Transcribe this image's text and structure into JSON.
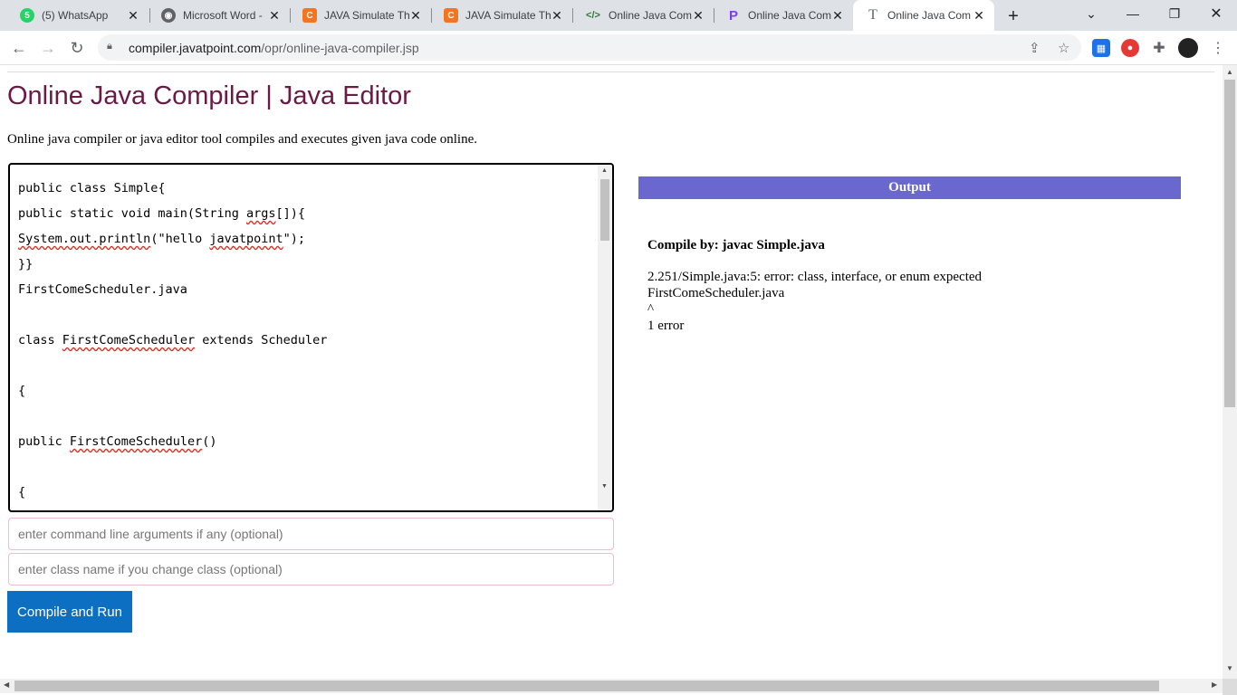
{
  "browser": {
    "tabs": [
      {
        "title": "(5) WhatsApp",
        "favicon": "whatsapp-icon",
        "favicon_glyph": "5",
        "favicon_color": "#25d366"
      },
      {
        "title": "Microsoft Word -",
        "favicon": "globe-icon",
        "favicon_glyph": "◉",
        "favicon_color": "#5f6368"
      },
      {
        "title": "JAVA Simulate Th",
        "favicon": "c-logo-icon",
        "favicon_glyph": "C",
        "favicon_color": "#f4741f"
      },
      {
        "title": "JAVA Simulate Th",
        "favicon": "c-logo-icon",
        "favicon_glyph": "C",
        "favicon_color": "#f4741f"
      },
      {
        "title": "Online Java Com",
        "favicon": "code-icon",
        "favicon_glyph": "</>",
        "favicon_color": "#2e7d32"
      },
      {
        "title": "Online Java Com",
        "favicon": "p-logo-icon",
        "favicon_glyph": "P",
        "favicon_color": "#7b3fe4"
      },
      {
        "title": "Online Java Com",
        "favicon": "t-logo-icon",
        "favicon_glyph": "T",
        "favicon_color": "#5f6368"
      }
    ],
    "active_tab_index": 6,
    "url_domain": "compiler.javatpoint.com",
    "url_path": "/opr/online-java-compiler.jsp"
  },
  "page": {
    "title": "Online Java Compiler | Java Editor",
    "description": "Online java compiler or java editor tool compiles and executes given java code online.",
    "code": [
      "public class Simple{",
      "public static void main(String args[]){",
      "System.out.println(\"hello javatpoint\");",
      "}}",
      "FirstComeScheduler.java",
      "",
      "class FirstComeScheduler extends Scheduler",
      "",
      "{",
      "",
      "public FirstComeScheduler()",
      "",
      "{"
    ],
    "args_placeholder": "enter command line arguments if any (optional)",
    "classname_placeholder": "enter class name if you change class (optional)",
    "run_button": "Compile and Run",
    "output": {
      "header": "Output",
      "compile_by": "Compile by: javac Simple.java",
      "lines": [
        "2.251/Simple.java:5: error: class, interface, or enum expected",
        "FirstComeScheduler.java",
        "^",
        "1 error"
      ]
    }
  }
}
